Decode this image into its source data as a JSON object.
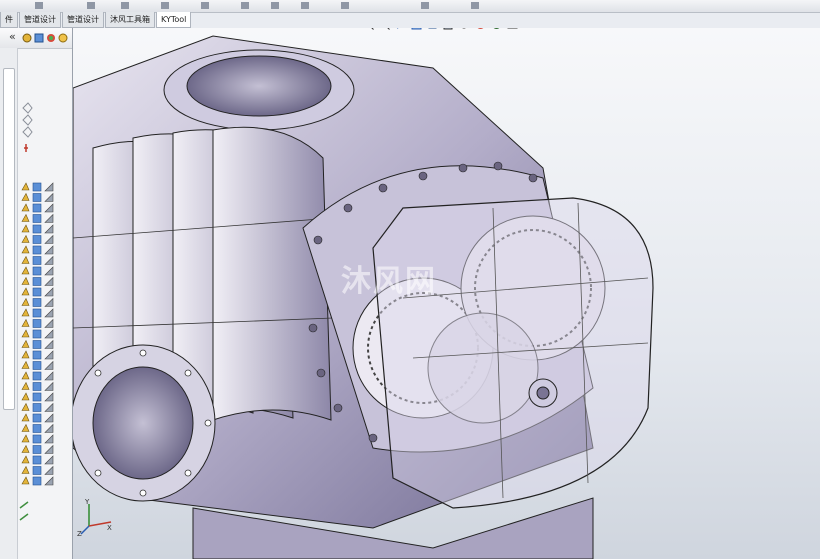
{
  "tabs": [
    {
      "label": "件"
    },
    {
      "label": "管道设计"
    },
    {
      "label": "管道设计"
    },
    {
      "label": "沐风工具箱"
    },
    {
      "label": "KYTool",
      "active": true
    }
  ],
  "watermark": "沐风网",
  "triad_axes": {
    "z": "Z",
    "x": "X",
    "y": "Y"
  },
  "left_pane": {
    "collapse_glyph": "«"
  },
  "colors": {
    "accent": "#2a5db0",
    "body": "#b3adc9",
    "gear": "#ece9f2",
    "background": "#e9ecf1"
  }
}
